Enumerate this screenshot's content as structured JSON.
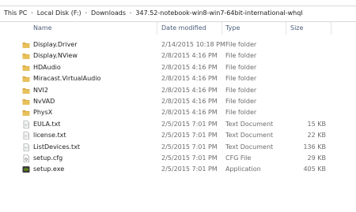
{
  "breadcrumb": {
    "items": [
      "This PC",
      "Local Disk (F:)",
      "Downloads",
      "347.52-notebook-win8-win7-64bit-international-whql"
    ],
    "separator": "›"
  },
  "columns": {
    "name": "Name",
    "date": "Date modified",
    "type": "Type",
    "size": "Size"
  },
  "files": [
    {
      "name": "Display.Driver",
      "date": "2/14/2015 10:18 PM",
      "type": "File folder",
      "size": "",
      "icon": "folder-icon"
    },
    {
      "name": "Display.NView",
      "date": "2/8/2015 4:16 PM",
      "type": "File folder",
      "size": "",
      "icon": "folder-icon"
    },
    {
      "name": "HDAudio",
      "date": "2/8/2015 4:16 PM",
      "type": "File folder",
      "size": "",
      "icon": "folder-icon"
    },
    {
      "name": "Miracast.VirtualAudio",
      "date": "2/8/2015 4:16 PM",
      "type": "File folder",
      "size": "",
      "icon": "folder-icon"
    },
    {
      "name": "NVI2",
      "date": "2/8/2015 4:16 PM",
      "type": "File folder",
      "size": "",
      "icon": "folder-icon"
    },
    {
      "name": "NvVAD",
      "date": "2/8/2015 4:16 PM",
      "type": "File folder",
      "size": "",
      "icon": "folder-icon"
    },
    {
      "name": "PhysX",
      "date": "2/8/2015 4:16 PM",
      "type": "File folder",
      "size": "",
      "icon": "folder-icon"
    },
    {
      "name": "EULA.txt",
      "date": "2/5/2015 7:01 PM",
      "type": "Text Document",
      "size": "15 KB",
      "icon": "text-file-icon"
    },
    {
      "name": "license.txt",
      "date": "2/5/2015 7:01 PM",
      "type": "Text Document",
      "size": "22 KB",
      "icon": "text-file-icon"
    },
    {
      "name": "ListDevices.txt",
      "date": "2/5/2015 7:01 PM",
      "type": "Text Document",
      "size": "136 KB",
      "icon": "text-file-icon"
    },
    {
      "name": "setup.cfg",
      "date": "2/5/2015 7:01 PM",
      "type": "CFG File",
      "size": "29 KB",
      "icon": "config-file-icon"
    },
    {
      "name": "setup.exe",
      "date": "2/5/2015 7:01 PM",
      "type": "Application",
      "size": "405 KB",
      "icon": "nvidia-app-icon"
    }
  ],
  "colors": {
    "folder": "#e8c15a",
    "folder_dark": "#d4a63c",
    "header_text": "#4c607a",
    "nvidia_green": "#76b900"
  }
}
